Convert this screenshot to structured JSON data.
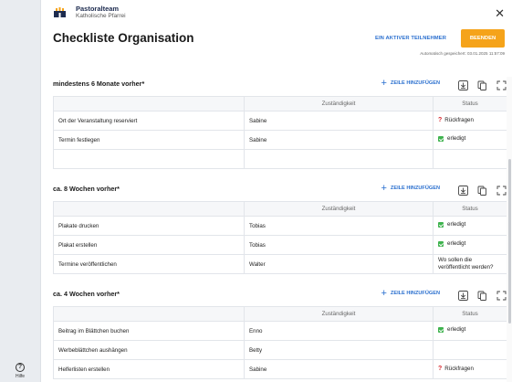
{
  "app": {
    "brand_name": "Pastoralteam",
    "brand_sub": "Katholische Pfarrei",
    "help_label": "Hilfe"
  },
  "header": {
    "title": "Checkliste Organisation",
    "participant_label": "EIN AKTIVER TEILNEHMER",
    "finish_label": "BEENDEN",
    "autosave": "Automatisch gespeichert: 03.01.2025 11:57:09"
  },
  "colors": {
    "accent_blue": "#2a6fcf",
    "finish_orange": "#f5a31a",
    "done_green": "#3fb34f",
    "ask_red": "#d7262d"
  },
  "table_headers": {
    "assignee": "Zuständigkeit",
    "status": "Status"
  },
  "add_row_label": "ZEILE HINZUFÜGEN",
  "sections": [
    {
      "title": "mindestens 6 Monate vorher*",
      "rows": [
        {
          "task": "Ort der Veranstaltung reserviert",
          "assignee": "Sabine",
          "status": "Rückfragen",
          "status_type": "ask"
        },
        {
          "task": "Termin festlegen",
          "assignee": "Sabine",
          "status": "erledigt",
          "status_type": "done"
        },
        {
          "task": "",
          "assignee": "",
          "status": "",
          "status_type": "none"
        }
      ]
    },
    {
      "title": "ca. 8 Wochen vorher*",
      "rows": [
        {
          "task": "Plakate drucken",
          "assignee": "Tobias",
          "status": "erledigt",
          "status_type": "done"
        },
        {
          "task": "Plakat erstellen",
          "assignee": "Tobias",
          "status": "erledigt",
          "status_type": "done"
        },
        {
          "task": "Termine veröffentlichen",
          "assignee": "Walter",
          "status": "Wo sollen die veröffentlicht werden?",
          "status_type": "text"
        }
      ]
    },
    {
      "title": "ca. 4 Wochen vorher*",
      "rows": [
        {
          "task": "Beitrag im Blättchen buchen",
          "assignee": "Enno",
          "status": "erledigt",
          "status_type": "done"
        },
        {
          "task": "Werbeblättchen aushängen",
          "assignee": "Betty",
          "status": "",
          "status_type": "none"
        },
        {
          "task": "Helferlisten erstellen",
          "assignee": "Sabine",
          "status": "Rückfragen",
          "status_type": "ask"
        }
      ]
    }
  ],
  "icons": {
    "logo": "church-team-logo",
    "close": "close-icon",
    "help": "help-circle-icon",
    "add": "plus-icon",
    "export": "download-icon",
    "copy": "copy-icon",
    "fullscreen": "expand-icon"
  }
}
